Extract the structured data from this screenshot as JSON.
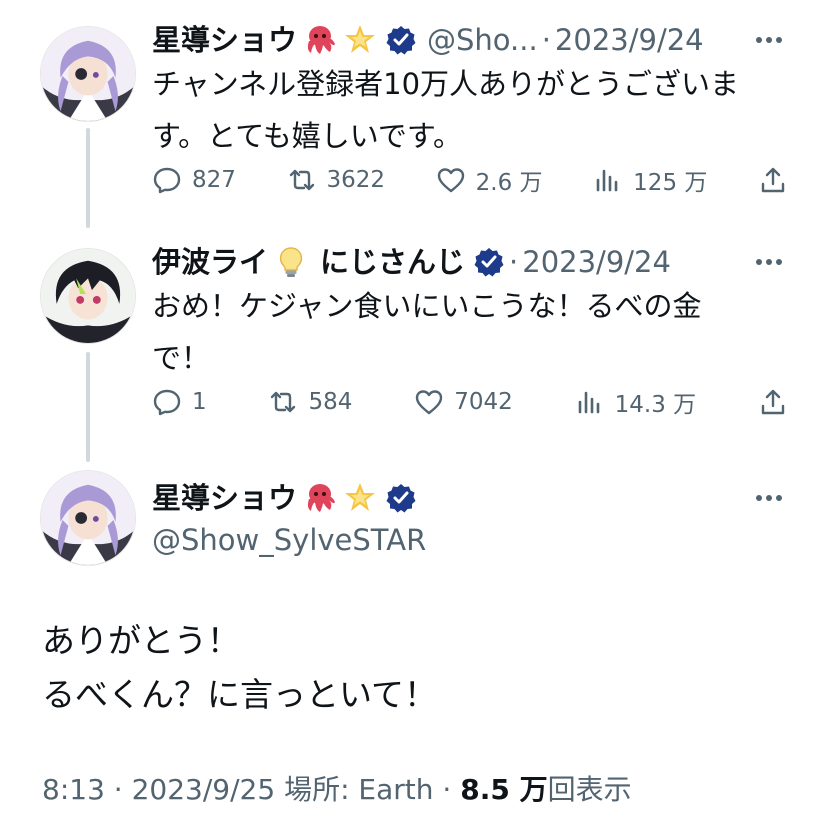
{
  "tweets": [
    {
      "name": "星導ショウ",
      "handle": "@Sho...",
      "separator": "·",
      "date": "2023/9/24",
      "text": "チャンネル登録者10万人ありがとうございます。とても嬉しいです。",
      "replies": "827",
      "retweets": "3622",
      "likes": "2.6 万",
      "views": "125 万",
      "emojis": [
        "octopus-emoji",
        "glowing-star-emoji"
      ]
    },
    {
      "name": "伊波ライ",
      "name_suffix": "にじさんじ",
      "separator": "·",
      "date": "2023/9/24",
      "text": "おめ！ケジャン食いにいこうな！るべの金で！",
      "replies": "1",
      "retweets": "584",
      "likes": "7042",
      "views": "14.3 万",
      "emojis": [
        "lightbulb-emoji"
      ]
    }
  ],
  "focus": {
    "name": "星導ショウ",
    "handle": "@Show_SylveSTAR",
    "text_line1": "ありがとう！",
    "text_line2": "るべくん？に言っといて！",
    "time": "8:13",
    "date": "2023/9/25",
    "location": "場所: Earth",
    "views_count": "8.5 万",
    "views_label": "回表示",
    "separator": "·"
  },
  "colors": {
    "text": "#0f1419",
    "secondary": "#536471",
    "thread_line": "#cfd9de",
    "verified_badge": "#1d3b8a"
  }
}
